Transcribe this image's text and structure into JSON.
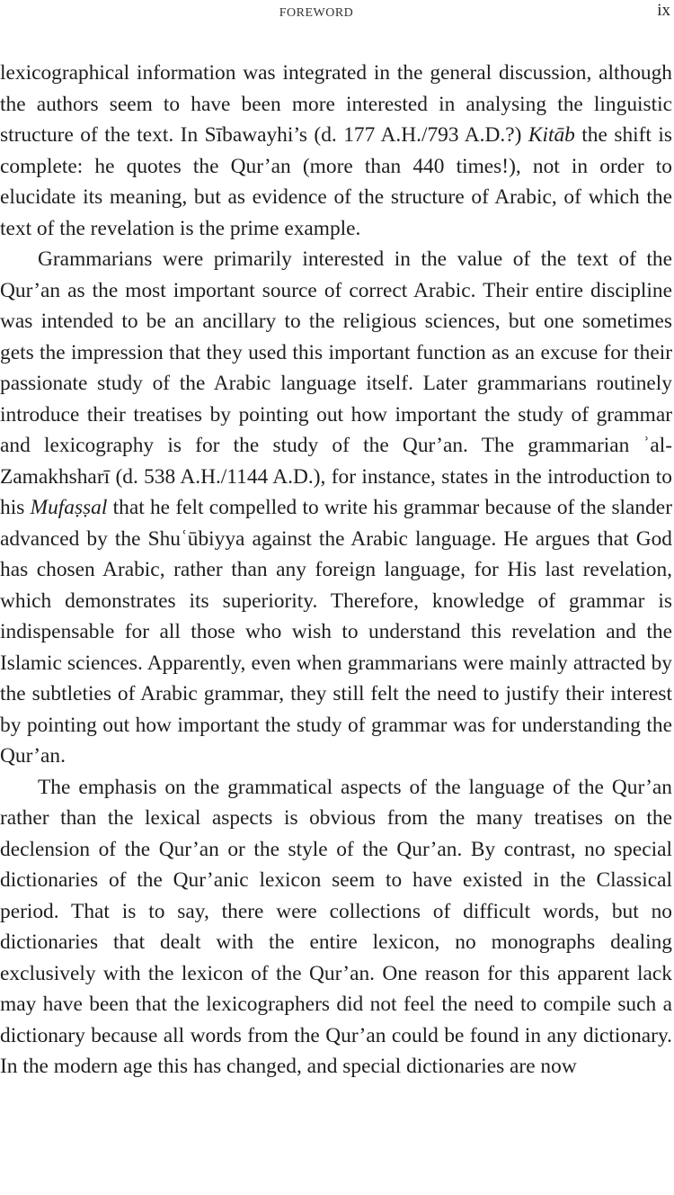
{
  "header": {
    "running_head": "FOREWORD",
    "page_number": "ix"
  },
  "paragraphs": [
    {
      "segments": [
        "lexicographical information was integrated in the general discussion, although the authors seem to have been more interested in analysing the linguistic structure of the text. In Sībawayhi’s (d. 177 A.H./793 A.D.?) ",
        "Kitāb",
        " the shift is complete: he quotes the Qur’an (more than 440 times!), not in order to elucidate its meaning, but as evidence of the structure of Arabic, of which the text of the revelation is the prime example."
      ]
    },
    {
      "segments": [
        "Grammarians were primarily interested in the value of the text of the Qur’an as the most important source of correct Arabic. Their entire discipline was intended to be an ancillary to the religious sciences, but one sometimes gets the impression that they used this important function as an excuse for their passionate study of the Arabic language itself. Later grammarians routinely introduce their treatises by pointing out how important the study of grammar and lexicography is for the study of the Qur’an. The grammarian ʾal-Zamakhsharī (d. 538 A.H./1144 A.D.), for instance, states in the introduction to his ",
        "Mufaṣṣal",
        " that he felt compelled to write his grammar because of the slander advanced by the Shuʿūbiyya against the Arabic language. He argues that God has chosen Arabic, rather than any foreign language, for His last revelation, which demonstrates its superiority. Therefore, knowledge of grammar is indispensable for all those who wish to understand this revelation and the Islamic sciences. Apparently, even when grammarians were mainly attracted by the subtleties of Arabic grammar, they still felt the need to justify their interest by pointing out how important the study of grammar was for understanding the Qur’an."
      ]
    },
    {
      "segments": [
        "The emphasis on the grammatical aspects of the language of the Qur’an rather than the lexical aspects is obvious from the many treatises on the declension of the Qur’an or the style of the Qur’an. By contrast, no special dictionaries of the Qur’anic lexicon seem to have existed in the Classical period. That is to say, there were collections of difficult words, but no dictionaries that dealt with the entire lexicon, no monographs dealing exclusively with the lexicon of the Qur’an. One reason for this apparent lack may have been that the lexicographers did not feel the need to compile such a dictionary because all words from the Qur’an could be found in any dictionary. In the modern age this has changed, and special dictionaries are now"
      ]
    }
  ]
}
